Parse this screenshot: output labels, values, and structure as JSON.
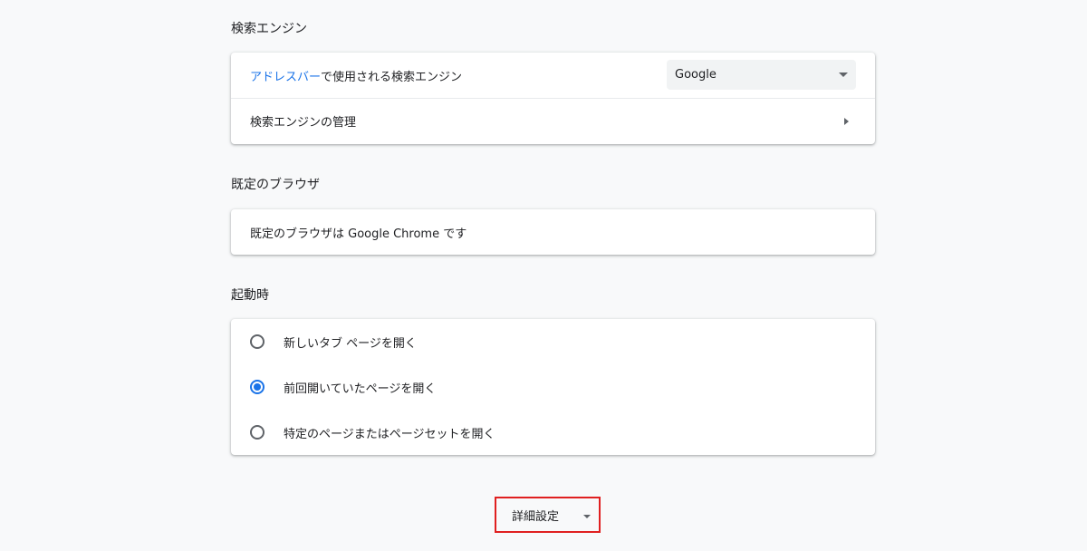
{
  "search_engine": {
    "title": "検索エンジン",
    "address_bar_link": "アドレスバー",
    "address_bar_rest": "で使用される検索エンジン",
    "selected_engine": "Google",
    "manage_label": "検索エンジンの管理"
  },
  "default_browser": {
    "title": "既定のブラウザ",
    "status": "既定のブラウザは Google Chrome です"
  },
  "startup": {
    "title": "起動時",
    "options": [
      {
        "label": "新しいタブ ページを開く",
        "checked": false
      },
      {
        "label": "前回開いていたページを開く",
        "checked": true
      },
      {
        "label": "特定のページまたはページセットを開く",
        "checked": false
      }
    ]
  },
  "advanced": {
    "label": "詳細設定"
  },
  "colors": {
    "accent": "#1a73e8",
    "highlight_border": "#e02020",
    "background": "#f8f9fa"
  }
}
